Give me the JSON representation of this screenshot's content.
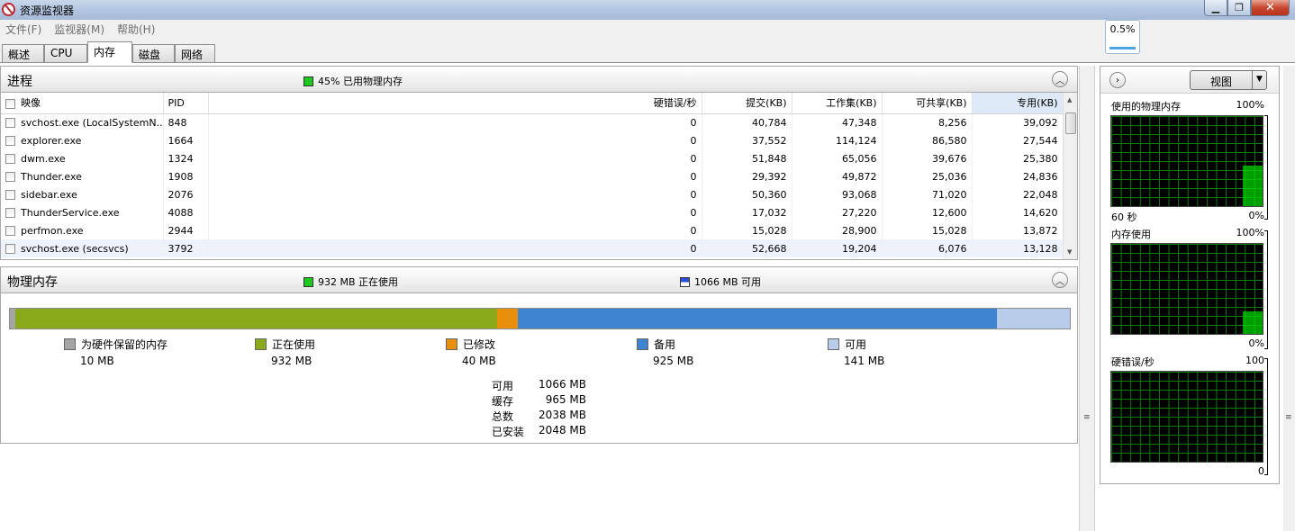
{
  "window": {
    "title": "资源监视器",
    "minimize": "▁",
    "maximize": "❐",
    "close": "✕"
  },
  "menu": [
    "文件(F)",
    "监视器(M)",
    "帮助(H)"
  ],
  "cpu_readout": "0.5%",
  "tabs": [
    "概述",
    "CPU",
    "内存",
    "磁盘",
    "网络"
  ],
  "active_tab": "内存",
  "processes": {
    "title": "进程",
    "stat_text": "45% 已用物理内存",
    "stat_color": "#1ec81e",
    "columns": [
      "映像",
      "PID",
      "硬错误/秒",
      "提交(KB)",
      "工作集(KB)",
      "可共享(KB)",
      "专用(KB)"
    ],
    "sorted_column": "专用(KB)",
    "rows": [
      [
        "svchost.exe (LocalSystemN...",
        "848",
        "0",
        "40,784",
        "47,348",
        "8,256",
        "39,092"
      ],
      [
        "explorer.exe",
        "1664",
        "0",
        "37,552",
        "114,124",
        "86,580",
        "27,544"
      ],
      [
        "dwm.exe",
        "1324",
        "0",
        "51,848",
        "65,056",
        "39,676",
        "25,380"
      ],
      [
        "Thunder.exe",
        "1908",
        "0",
        "29,392",
        "49,872",
        "25,036",
        "24,836"
      ],
      [
        "sidebar.exe",
        "2076",
        "0",
        "50,360",
        "93,068",
        "71,020",
        "22,048"
      ],
      [
        "ThunderService.exe",
        "4088",
        "0",
        "17,032",
        "27,220",
        "12,600",
        "14,620"
      ],
      [
        "perfmon.exe",
        "2944",
        "0",
        "15,028",
        "28,900",
        "15,028",
        "13,872"
      ],
      [
        "svchost.exe (secsvcs)",
        "3792",
        "0",
        "52,668",
        "19,204",
        "6,076",
        "13,128"
      ]
    ]
  },
  "physical_memory": {
    "title": "物理内存",
    "in_use_text": "932 MB 正在使用",
    "available_text": "1066 MB 可用",
    "bar": [
      {
        "name": "为硬件保留的内存",
        "value_mb": 10,
        "color": "#a6a6a6"
      },
      {
        "name": "正在使用",
        "value_mb": 932,
        "color": "#8aaa1b"
      },
      {
        "name": "已修改",
        "value_mb": 40,
        "color": "#e8900c"
      },
      {
        "name": "备用",
        "value_mb": 925,
        "color": "#3f84d0"
      },
      {
        "name": "可用",
        "value_mb": 141,
        "color": "#b7cde9"
      }
    ],
    "legend": [
      {
        "label": "为硬件保留的内存",
        "value": "10 MB",
        "color": "#a6a6a6"
      },
      {
        "label": "正在使用",
        "value": "932 MB",
        "color": "#8aaa1b"
      },
      {
        "label": "已修改",
        "value": "40 MB",
        "color": "#e8900c"
      },
      {
        "label": "备用",
        "value": "925 MB",
        "color": "#3f84d0"
      },
      {
        "label": "可用",
        "value": "141 MB",
        "color": "#b7cde9"
      }
    ],
    "summary": [
      {
        "key": "可用",
        "value": "1066 MB"
      },
      {
        "key": "缓存",
        "value": "965 MB"
      },
      {
        "key": "总数",
        "value": "2038 MB"
      },
      {
        "key": "已安装",
        "value": "2048 MB"
      }
    ]
  },
  "right_panel": {
    "view_label": "视图",
    "graphs": [
      {
        "title": "使用的物理内存",
        "max": "100%",
        "min": "0%",
        "time": "60 秒",
        "current_pct": 45
      },
      {
        "title": "内存使用",
        "max": "100%",
        "min": "0%",
        "time": "",
        "current_pct": 25
      },
      {
        "title": "硬错误/秒",
        "max": "100",
        "min": "0",
        "time": "",
        "current_pct": 0
      }
    ]
  },
  "colors": {
    "in_use": "#1ec81e",
    "available": "#2a4fd6",
    "graph_line": "#00d200"
  }
}
